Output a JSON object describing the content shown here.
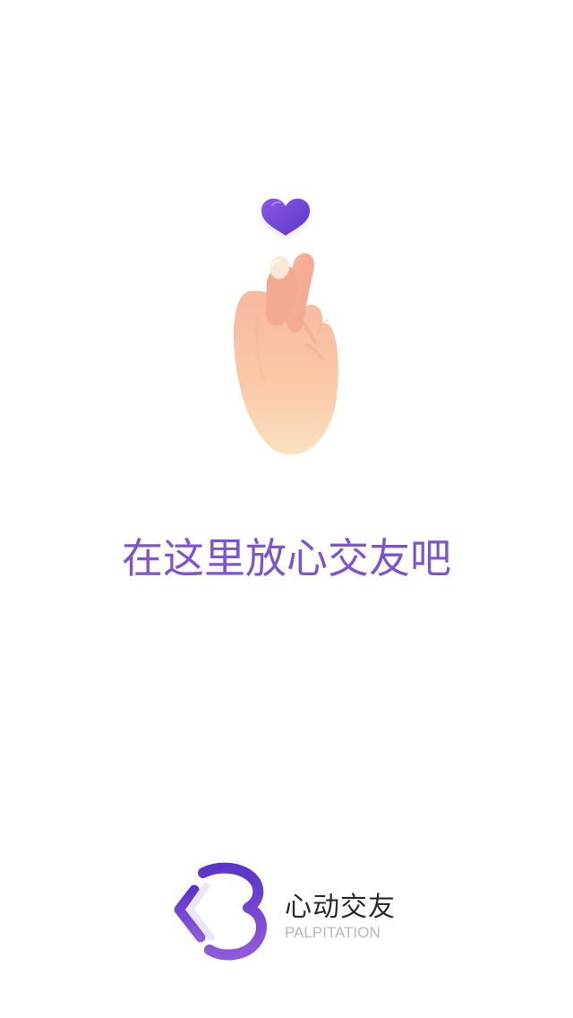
{
  "splash": {
    "tagline": "在这里放心交友吧"
  },
  "brand": {
    "name": "心动交友",
    "subtitle": "PALPITATION"
  },
  "colors": {
    "accent": "#7b56d1",
    "heart": "#6a42c8",
    "logoGradientStart": "#5a35c9",
    "logoGradientEnd": "#8e5ad9",
    "text": "#2a2a2a",
    "subtext": "#b7b7b7",
    "background": "#ffffff"
  },
  "icons": {
    "heart": "heart-icon",
    "hand": "finger-heart-hand-icon",
    "logo": "palpitation-logo-icon"
  }
}
